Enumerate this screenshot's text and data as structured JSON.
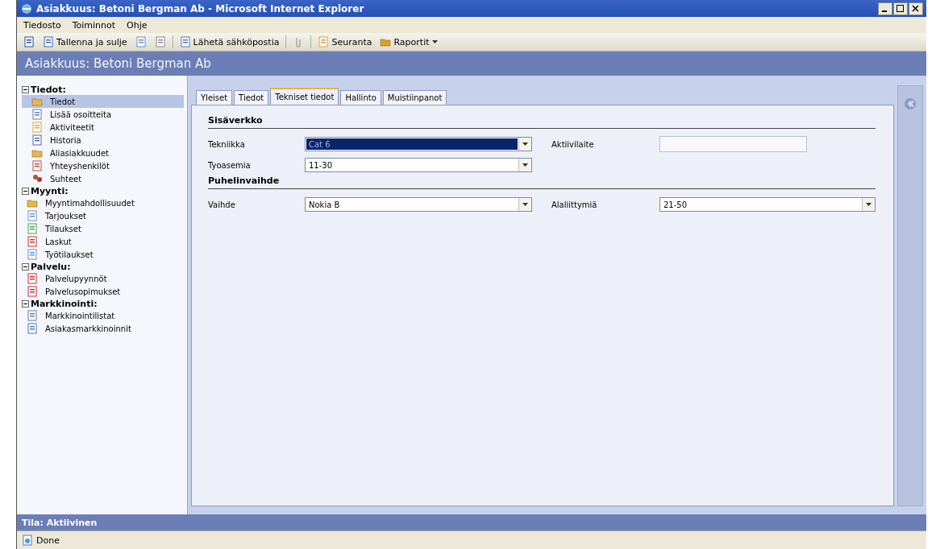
{
  "window": {
    "title": "Asiakkuus: Betoni Bergman Ab - Microsoft Internet Explorer"
  },
  "menu": [
    {
      "label": "Tiedosto"
    },
    {
      "label": "Toiminnot"
    },
    {
      "label": "Ohje"
    }
  ],
  "toolbar": [
    {
      "kind": "icon"
    },
    {
      "kind": "button",
      "label": "Tallenna ja sulje"
    },
    {
      "kind": "icon"
    },
    {
      "kind": "icon"
    },
    {
      "kind": "separator"
    },
    {
      "kind": "button",
      "label": "Lähetä sähköpostia"
    },
    {
      "kind": "separator"
    },
    {
      "kind": "icon"
    },
    {
      "kind": "separator"
    },
    {
      "kind": "button",
      "label": "Seuranta"
    },
    {
      "kind": "menu",
      "label": "Raportit"
    }
  ],
  "form_header": {
    "title": "Asiakkuus: Betoni Bergman Ab"
  },
  "sidebar": {
    "groups": [
      {
        "label": "Tiedot:",
        "expanded": true,
        "items": [
          {
            "label": "Tiedot",
            "selected": true
          },
          {
            "label": "Lisää osoitteita",
            "selected": false
          },
          {
            "label": "Aktiviteetit",
            "selected": false
          },
          {
            "label": "Historia",
            "selected": false
          },
          {
            "label": "Aliasiakkuudet",
            "selected": false
          },
          {
            "label": "Yhteyshenkilöt",
            "selected": false
          },
          {
            "label": "Suhteet",
            "selected": false
          }
        ]
      },
      {
        "label": "Myynti:",
        "expanded": true,
        "items": [
          {
            "label": "Myyntimahdollisuudet",
            "selected": false
          },
          {
            "label": "Tarjoukset",
            "selected": false
          },
          {
            "label": "Tilaukset",
            "selected": false
          },
          {
            "label": "Laskut",
            "selected": false
          },
          {
            "label": "Työtilaukset",
            "selected": false
          }
        ]
      },
      {
        "label": "Palvelu:",
        "expanded": true,
        "items": [
          {
            "label": "Palvelupyynnöt",
            "selected": false
          },
          {
            "label": "Palvelusopimukset",
            "selected": false
          }
        ]
      },
      {
        "label": "Markkinointi:",
        "expanded": true,
        "items": [
          {
            "label": "Markkinointilistat",
            "selected": false
          },
          {
            "label": "Asiakasmarkkinoinnit",
            "selected": false
          }
        ]
      }
    ]
  },
  "tabs": [
    {
      "label": "Yleiset",
      "selected": false
    },
    {
      "label": "Tiedot",
      "selected": false
    },
    {
      "label": "Tekniset tiedot",
      "selected": true
    },
    {
      "label": "Hallinto",
      "selected": false
    },
    {
      "label": "Muistiinpanot",
      "selected": false
    }
  ],
  "sections": [
    {
      "title": "Sisäverkko",
      "rows": [
        [
          {
            "label": "Tekniikka",
            "kind": "select",
            "value": "Cat 6",
            "focused": true
          },
          {
            "label": "Aktiivilaite",
            "kind": "text"
          }
        ],
        [
          {
            "label": "Tyoasemia",
            "kind": "select",
            "value": "11-30",
            "focused": false
          }
        ]
      ]
    },
    {
      "title": "Puhelinvaihde",
      "rows": [
        [
          {
            "label": "Vaihde",
            "kind": "select",
            "value": "Nokia B",
            "focused": false
          },
          {
            "label": "Alaliittymiä",
            "kind": "select",
            "value": "21-50",
            "focused": false
          }
        ]
      ]
    }
  ],
  "form_status": "Tila: Aktiivinen",
  "status_bar": {
    "text": "Done"
  }
}
